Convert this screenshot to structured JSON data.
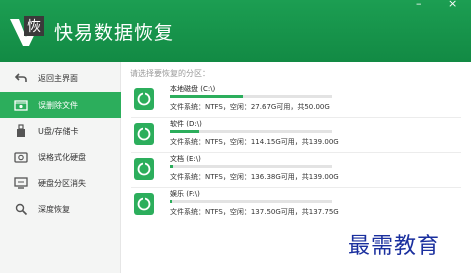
{
  "app": {
    "title": "快易数据恢复",
    "logo_char": "恢",
    "minimize_glyph": "–",
    "close_glyph": "×"
  },
  "sidebar": {
    "items": [
      {
        "label": "返回主界面",
        "icon": "back-arrow-icon",
        "active": false
      },
      {
        "label": "误删除文件",
        "icon": "folder-icon",
        "active": true
      },
      {
        "label": "U盘/存储卡",
        "icon": "usb-drive-icon",
        "active": false
      },
      {
        "label": "误格式化硬盘",
        "icon": "hard-disk-icon",
        "active": false
      },
      {
        "label": "硬盘分区消失",
        "icon": "partition-icon",
        "active": false
      },
      {
        "label": "深度恢复",
        "icon": "deep-scan-icon",
        "active": false
      }
    ]
  },
  "main": {
    "prompt": "请选择要恢复的分区：",
    "drives": [
      {
        "name": "本地磁盘 (C:\\)",
        "detail": "文件系统：NTFS，空闲：27.67G可用，共50.00G",
        "used_fraction": 0.45
      },
      {
        "name": "软件 (D:\\)",
        "detail": "文件系统：NTFS，空闲：114.15G可用，共139.00G",
        "used_fraction": 0.18
      },
      {
        "name": "文档 (E:\\)",
        "detail": "文件系统：NTFS，空闲：136.38G可用，共139.00G",
        "used_fraction": 0.02
      },
      {
        "name": "娱乐 (F:\\)",
        "detail": "文件系统：NTFS，空闲：137.50G可用，共137.75G",
        "used_fraction": 0.01
      }
    ]
  },
  "watermark": "最需教育",
  "colors": {
    "brand_green": "#1c9e52",
    "active_green": "#2cae5c",
    "watermark_blue": "#1a2f9e"
  }
}
